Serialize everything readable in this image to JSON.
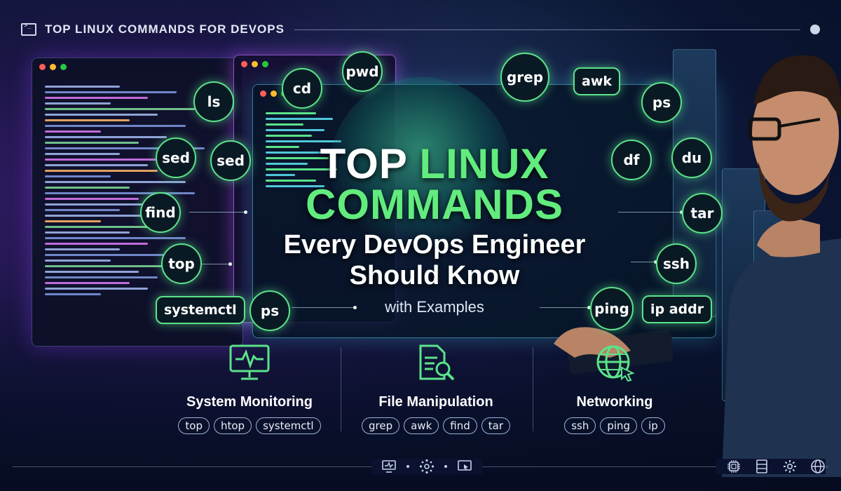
{
  "header": {
    "title": "TOP LINUX COMMANDS FOR DEVOPS"
  },
  "headline": {
    "line1_white": "TOP",
    "line1_green": "LINUX",
    "line2_green": "COMMANDS",
    "line3": "Every DevOps Engineer",
    "line4": "Should Know",
    "line5": "with Examples"
  },
  "commands": {
    "ls": "ls",
    "cd": "cd",
    "pwd": "pwd",
    "grep": "grep",
    "awk": "awk",
    "ps_right": "ps",
    "sed_a": "sed",
    "sed_b": "sed",
    "df": "df",
    "du": "du",
    "find": "find",
    "tar": "tar",
    "top": "top",
    "ssh": "ssh",
    "systemctl": "systemctl",
    "ps_left": "ps",
    "ping": "ping",
    "ip_addr": "ip addr"
  },
  "categories": [
    {
      "title": "System Monitoring",
      "icon": "monitor-pulse-icon",
      "tags": [
        "top",
        "htop",
        "systemctl"
      ]
    },
    {
      "title": "File Manipulation",
      "icon": "document-search-icon",
      "tags": [
        "grep",
        "awk",
        "find",
        "tar"
      ]
    },
    {
      "title": "Networking",
      "icon": "globe-cursor-icon",
      "tags": [
        "ssh",
        "ping",
        "ip"
      ]
    }
  ],
  "colors": {
    "accent_green": "#62ec7e",
    "bubble_border": "#5be38a",
    "bg_dark": "#0b1533",
    "purple_glow": "#7a3cff"
  }
}
